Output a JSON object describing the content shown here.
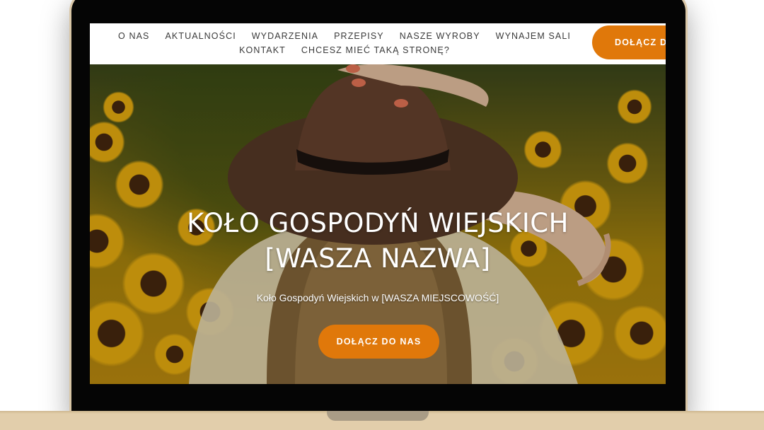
{
  "nav": {
    "links": [
      "O NAS",
      "AKTUALNOŚCI",
      "WYDARZENIA",
      "PRZEPISY",
      "NASZE WYROBY",
      "WYNAJEM SALI",
      "KONTAKT",
      "CHCESZ MIEĆ TAKĄ STRONĘ?"
    ],
    "cta_label": "DOŁĄCZ DO"
  },
  "hero": {
    "title_line1": "KOŁO GOSPODYŃ WIEJSKICH",
    "title_line2": "[WASZA NAZWA]",
    "subtitle": "Koło Gospodyń Wiejskich w [WASZA MIEJSCOWOŚĆ]",
    "cta_label": "DOŁĄCZ DO NAS"
  },
  "colors": {
    "accent": "#e0780a",
    "nav_text": "#3a3a3a",
    "laptop_frame": "#050505",
    "laptop_base": "#e2ceab"
  }
}
